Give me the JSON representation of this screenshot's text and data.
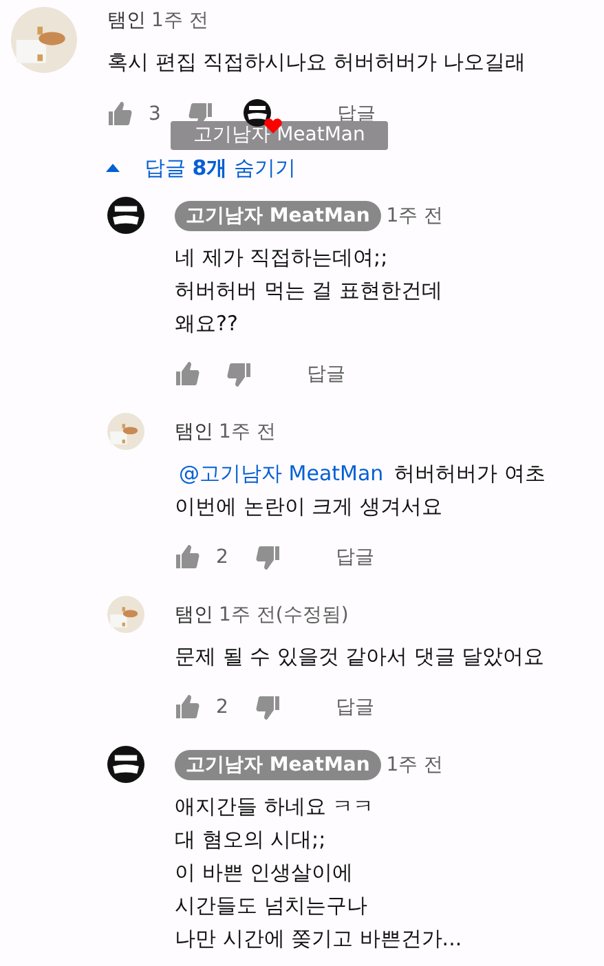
{
  "comment": {
    "author": "탬인",
    "time": "1주 전",
    "owner": false,
    "body": [
      "혹시 편집 직접하시나요 허버허버가 나오길래"
    ],
    "likes": "3",
    "hearted": true,
    "reply_label": "답글",
    "tooltip": "고기남자 MeatMan"
  },
  "replies_toggle": {
    "label": "답글 **8개** 숨기기",
    "expanded": true
  },
  "replies": [
    {
      "author": "고기남자 MeatMan",
      "time": "1주 전",
      "owner": true,
      "body": [
        "네 제가 직접하는데여;;",
        "허버허버 먹는 걸 표현한건데",
        "왜요??"
      ],
      "reply_label": "답글"
    },
    {
      "author": "탬인",
      "time": "1주 전",
      "owner": false,
      "mention": "@고기남자 MeatMan",
      "body": [
        "허버허버가 여초",
        "이번에 논란이 크게 생겨서요"
      ],
      "likes": "2",
      "reply_label": "답글"
    },
    {
      "author": "탬인",
      "time": "1주 전(수정됨)",
      "owner": false,
      "body": [
        "문제 될 수 있을것 같아서 댓글 달았어요"
      ],
      "likes": "2",
      "reply_label": "답글"
    },
    {
      "author": "고기남자 MeatMan",
      "time": "1주 전",
      "owner": true,
      "body": [
        "애지간들 하네요 ㅋㅋ",
        "대 혐오의 시대;;",
        "이 바쁜 인생살이에",
        "시간들도 넘치는구나",
        "나만 시간에 쫒기고 바쁜건가..."
      ]
    }
  ]
}
